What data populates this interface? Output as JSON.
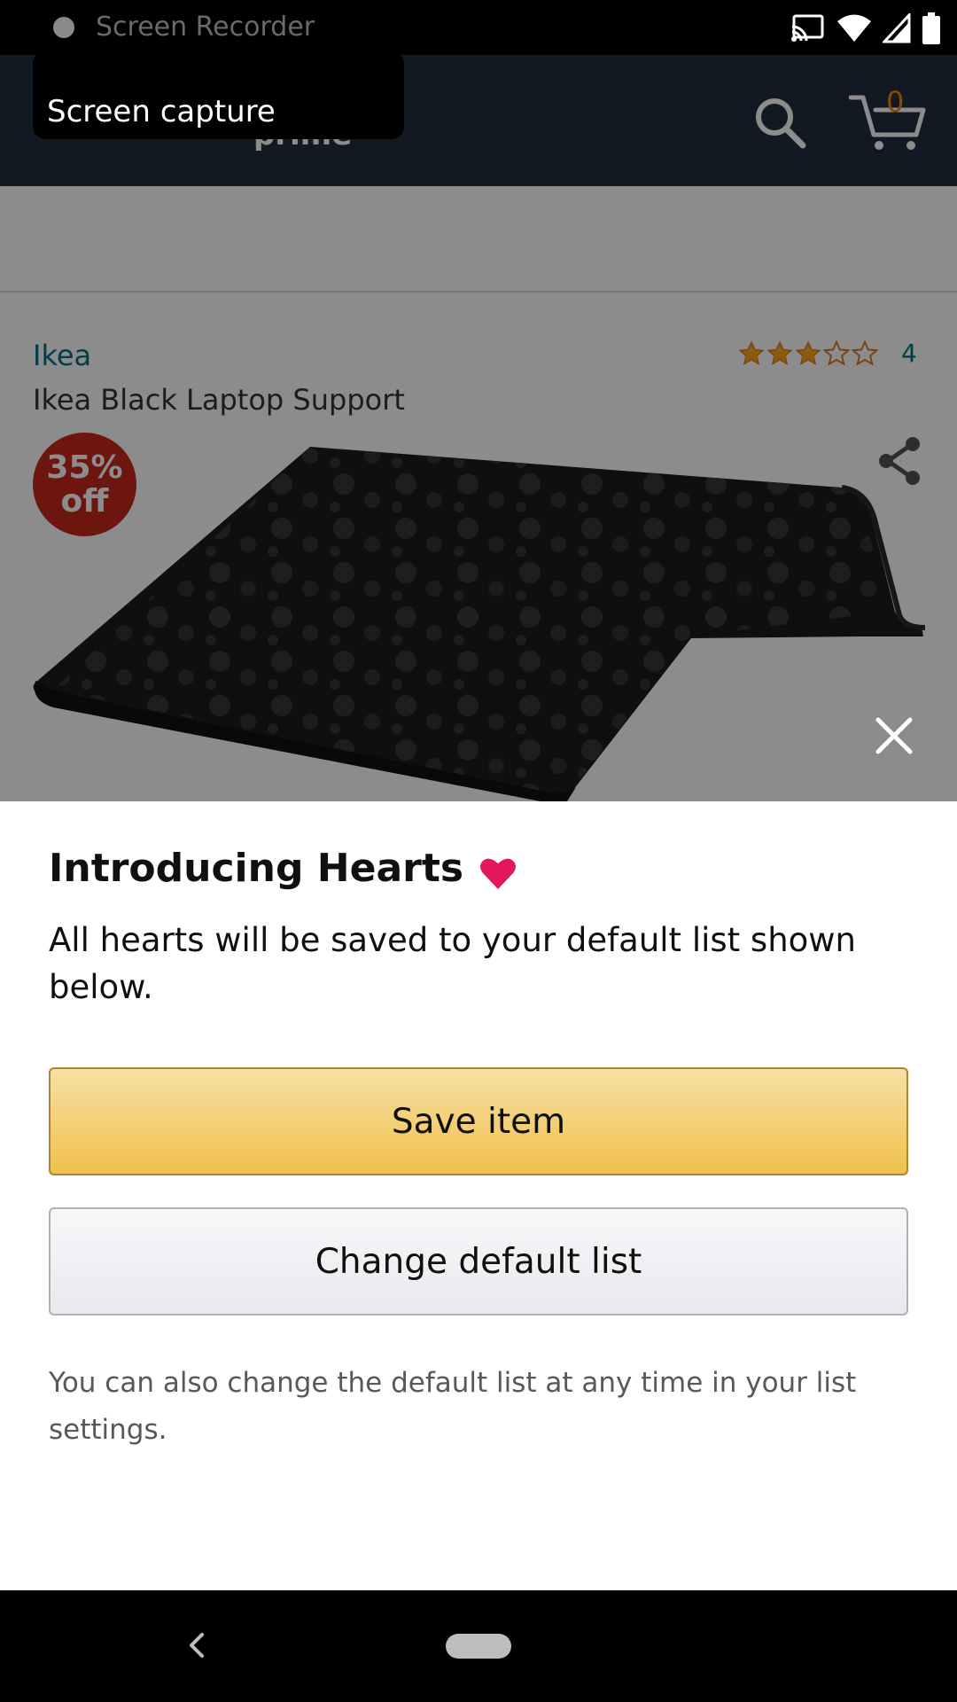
{
  "status_bar": {
    "recorder_label": "Screen Recorder",
    "icons": [
      "cast-icon",
      "wifi-icon",
      "signal-icon",
      "battery-icon"
    ]
  },
  "header": {
    "prime_text": "prime",
    "screen_capture_toast": "Screen capture",
    "cart_count": "0",
    "colors": {
      "background": "#232f3e",
      "cart_count": "#f08804"
    }
  },
  "product": {
    "brand": "Ikea",
    "title": "Ikea Black Laptop Support",
    "rating_stars": 3,
    "rating_max": 5,
    "rating_count": "4",
    "discount_line1": "35%",
    "discount_line2": "off",
    "colors": {
      "discount_badge": "#c7271c",
      "link": "#007185"
    }
  },
  "sheet": {
    "title": "Introducing Hearts",
    "description": "All hearts will be saved to your default list shown below.",
    "save_button": "Save item",
    "change_button": "Change default list",
    "note": "You can also change the default list at any time in your list settings.",
    "colors": {
      "heart": "#e3175e",
      "save_button": "#f0c14b"
    }
  }
}
